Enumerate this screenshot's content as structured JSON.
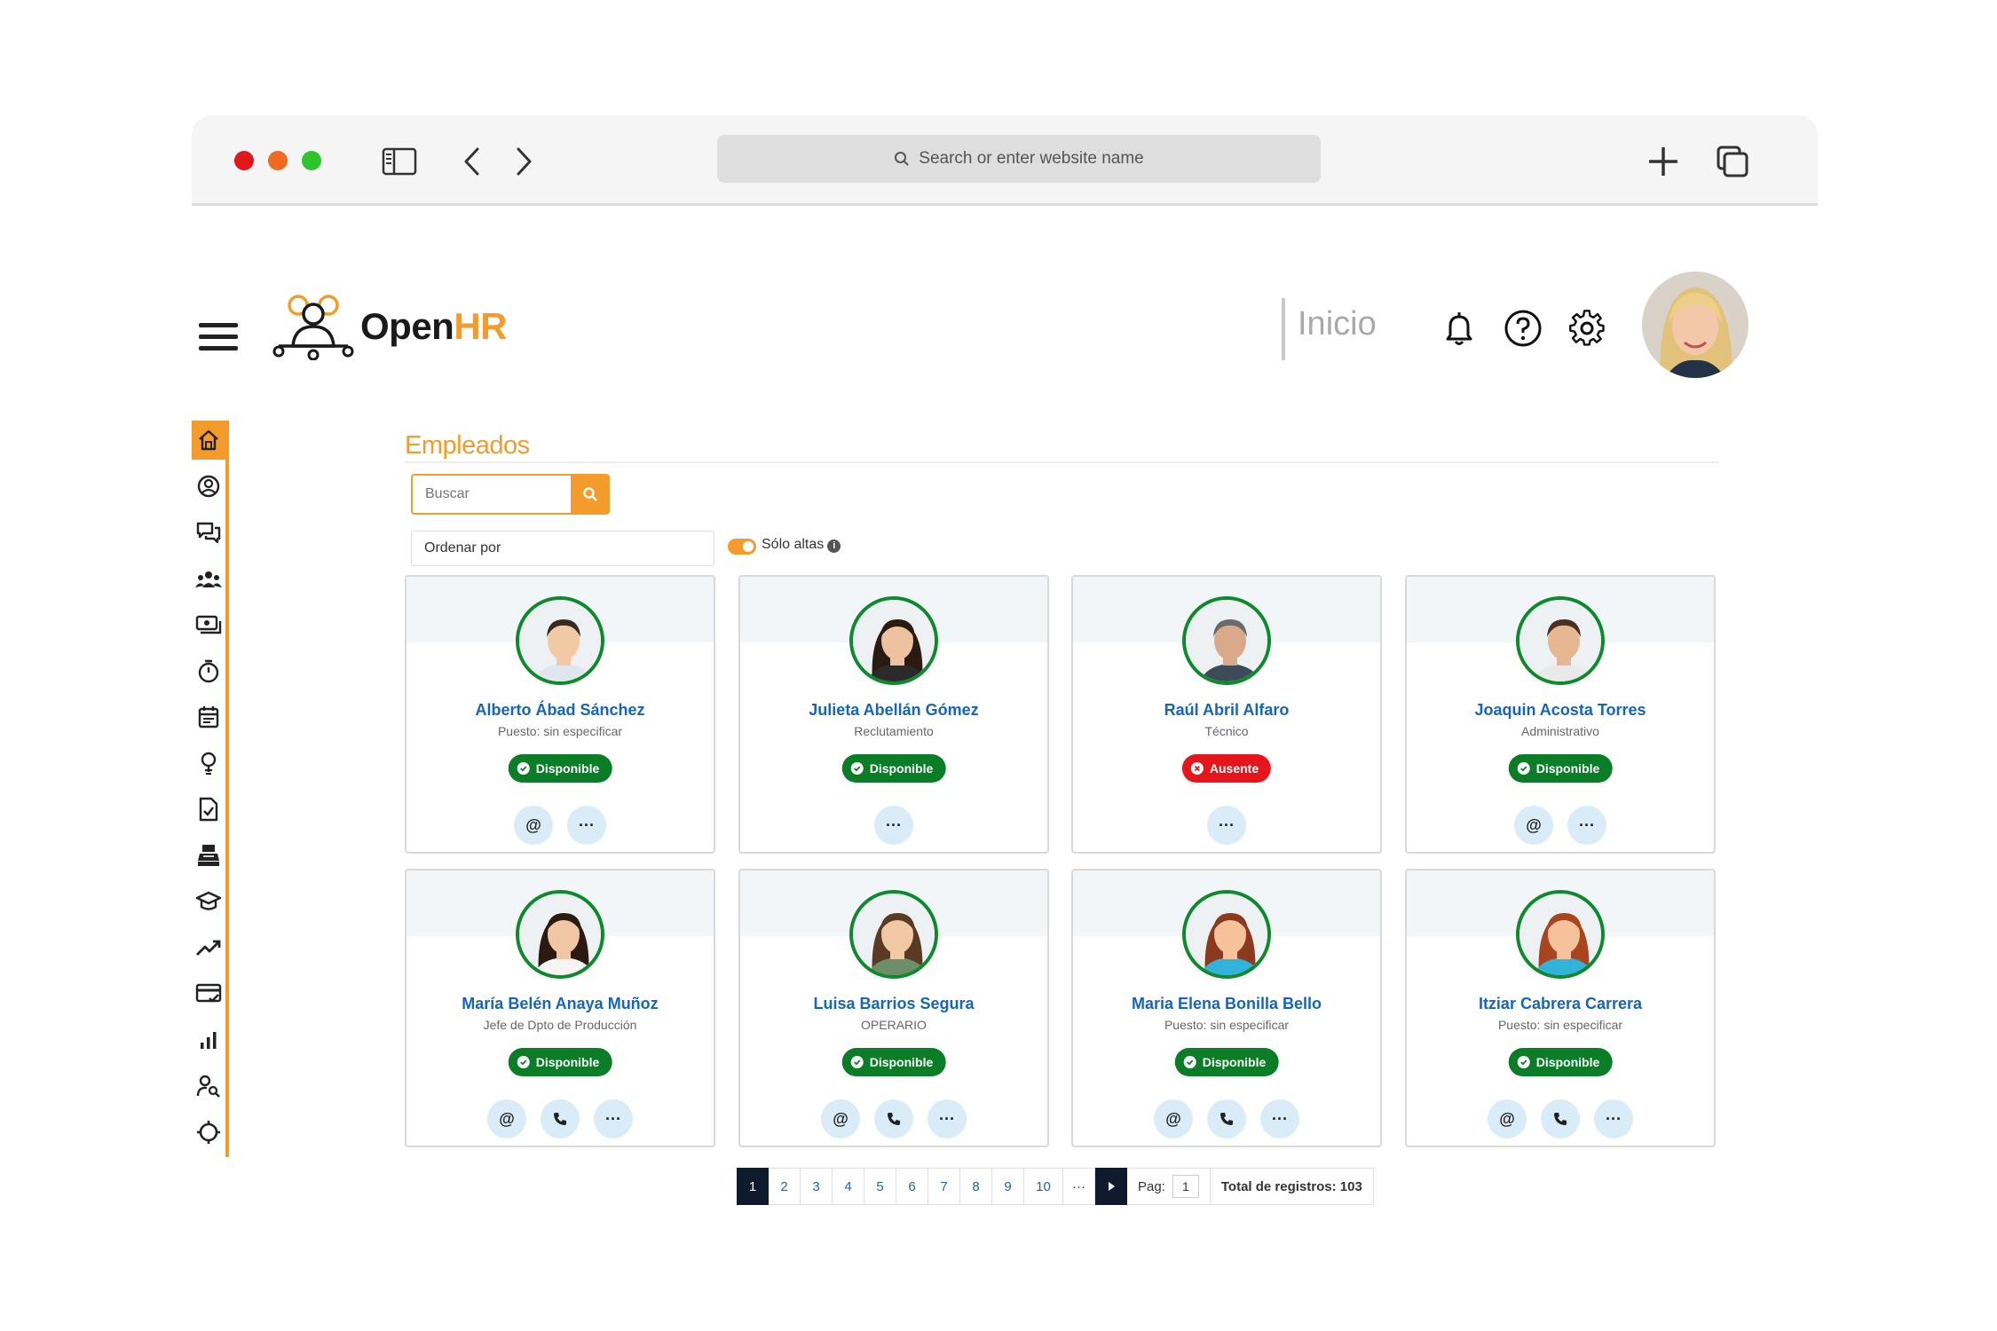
{
  "browser": {
    "url_placeholder": "Search or enter website name"
  },
  "header": {
    "logo_open": "Open",
    "logo_hr": "HR",
    "inicio": "Inicio"
  },
  "colors": {
    "brand": "#f39c2b",
    "link": "#1566b8",
    "available": "#0b7d27",
    "absent": "#e4161b",
    "dark": "#0f1b2d"
  },
  "sidebar": {
    "items": [
      {
        "icon": "home-icon",
        "active": true
      },
      {
        "icon": "user-circle-icon"
      },
      {
        "icon": "chat-icon"
      },
      {
        "icon": "team-icon"
      },
      {
        "icon": "payroll-icon"
      },
      {
        "icon": "stopwatch-icon"
      },
      {
        "icon": "calendar-icon"
      },
      {
        "icon": "lightbulb-icon"
      },
      {
        "icon": "document-check-icon"
      },
      {
        "icon": "cash-register-icon"
      },
      {
        "icon": "graduation-cap-icon"
      },
      {
        "icon": "trend-up-icon"
      },
      {
        "icon": "card-check-icon"
      },
      {
        "icon": "bar-chart-icon"
      },
      {
        "icon": "user-search-icon"
      },
      {
        "icon": "target-icon"
      }
    ]
  },
  "main": {
    "title": "Empleados",
    "search_placeholder": "Buscar",
    "order_label": "Ordenar por",
    "toggle_label": "Sólo altas",
    "info_glyph": "i"
  },
  "employees": [
    {
      "name": "Alberto Ábad Sánchez",
      "role": "Puesto: sin especificar",
      "status": "Disponible",
      "status_type": "ok",
      "actions": [
        "@",
        "···"
      ]
    },
    {
      "name": "Julieta Abellán Gómez",
      "role": "Reclutamiento",
      "status": "Disponible",
      "status_type": "ok",
      "actions": [
        "···"
      ]
    },
    {
      "name": "Raúl Abril Alfaro",
      "role": "Técnico",
      "status": "Ausente",
      "status_type": "away",
      "actions": [
        "···"
      ]
    },
    {
      "name": "Joaquin Acosta Torres",
      "role": "Administrativo",
      "status": "Disponible",
      "status_type": "ok",
      "actions": [
        "@",
        "···"
      ]
    },
    {
      "name": "María Belén Anaya Muñoz",
      "role": "Jefe de Dpto de Producción",
      "status": "Disponible",
      "status_type": "ok",
      "actions": [
        "@",
        "phone",
        "···"
      ]
    },
    {
      "name": "Luisa Barrios Segura",
      "role": "OPERARIO",
      "status": "Disponible",
      "status_type": "ok",
      "actions": [
        "@",
        "phone",
        "···"
      ]
    },
    {
      "name": "Maria Elena Bonilla Bello",
      "role": "Puesto: sin especificar",
      "status": "Disponible",
      "status_type": "ok",
      "actions": [
        "@",
        "phone",
        "···"
      ]
    },
    {
      "name": "Itziar Cabrera Carrera",
      "role": "Puesto: sin especificar",
      "status": "Disponible",
      "status_type": "ok",
      "actions": [
        "@",
        "phone",
        "···"
      ]
    }
  ],
  "pagination": {
    "pages": [
      "1",
      "2",
      "3",
      "4",
      "5",
      "6",
      "7",
      "8",
      "9",
      "10"
    ],
    "current": "1",
    "ellipsis": "···",
    "page_label": "Pag:",
    "page_value": "1",
    "total_label": "Total de registros: 103"
  }
}
